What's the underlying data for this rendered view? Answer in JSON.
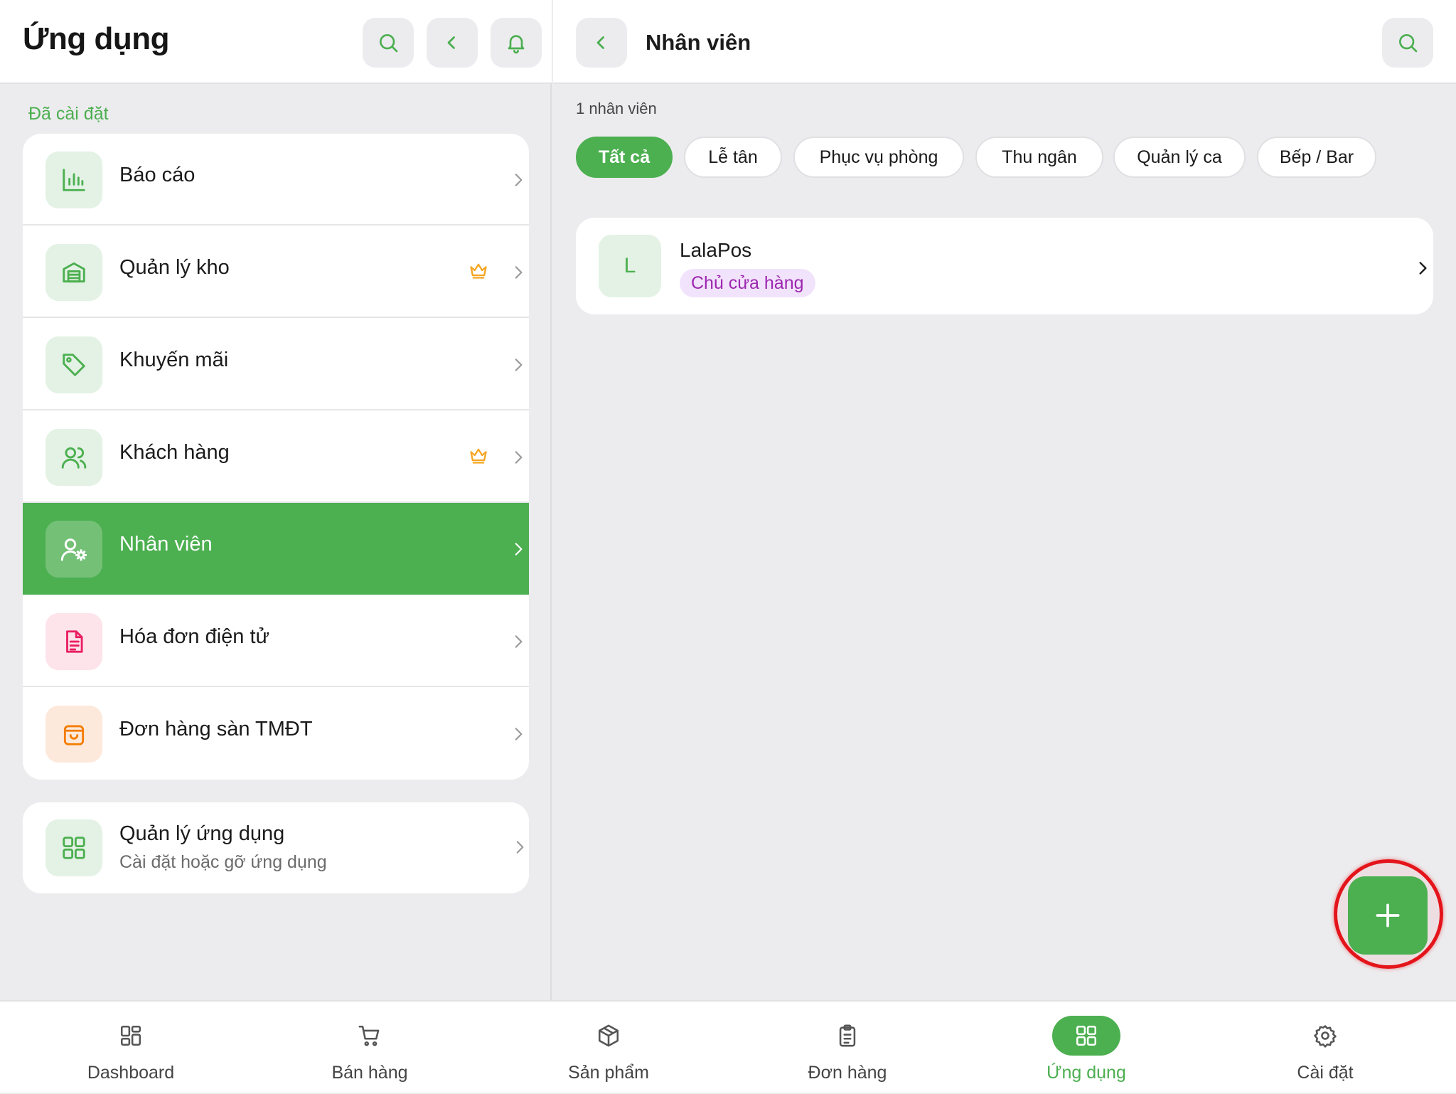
{
  "left": {
    "title": "Ứng dụng",
    "section_label": "Đã cài đặt",
    "items": [
      {
        "label": "Báo cáo",
        "icon": "bar-chart-icon"
      },
      {
        "label": "Quản lý kho",
        "icon": "warehouse-icon",
        "premium": true
      },
      {
        "label": "Khuyến mãi",
        "icon": "tag-icon"
      },
      {
        "label": "Khách hàng",
        "icon": "users-icon",
        "premium": true
      },
      {
        "label": "Nhân viên",
        "icon": "user-gear-icon",
        "active": true
      },
      {
        "label": "Hóa đơn điện tử",
        "icon": "document-icon"
      },
      {
        "label": "Đơn hàng sàn TMĐT",
        "icon": "shopping-bag-icon"
      }
    ],
    "apps_card": {
      "title": "Quản lý ứng dụng",
      "subtitle": "Cài đặt hoặc gỡ ứng dụng"
    }
  },
  "right": {
    "title": "Nhân viên",
    "count_label": "1 nhân viên",
    "filters": [
      "Tất cả",
      "Lễ tân",
      "Phục vụ phòng",
      "Thu ngân",
      "Quản lý ca",
      "Bếp / Bar"
    ],
    "active_filter": "Tất cả",
    "staff": [
      {
        "initial": "L",
        "name": "LalaPos",
        "role": "Chủ cửa hàng"
      }
    ]
  },
  "bottom_nav": [
    {
      "label": "Dashboard",
      "icon": "dashboard-icon"
    },
    {
      "label": "Bán hàng",
      "icon": "cart-icon"
    },
    {
      "label": "Sản phẩm",
      "icon": "box-icon"
    },
    {
      "label": "Đơn hàng",
      "icon": "clipboard-icon"
    },
    {
      "label": "Ứng dụng",
      "icon": "apps-grid-icon",
      "active": true
    },
    {
      "label": "Cài đặt",
      "icon": "settings-icon"
    }
  ],
  "colors": {
    "accent": "#4caf50",
    "premium": "#f5a623",
    "role_badge_bg": "#f2e3fc",
    "role_badge_text": "#9c27b0",
    "highlight_ring": "#e4141b"
  }
}
